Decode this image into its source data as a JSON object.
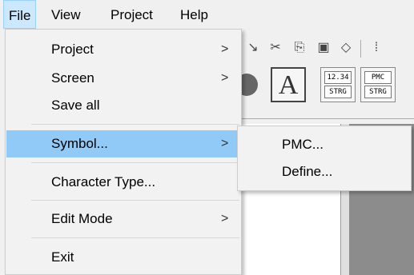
{
  "menubar": {
    "items": [
      {
        "label": "File",
        "active": true
      },
      {
        "label": "View"
      },
      {
        "label": "Project"
      },
      {
        "label": "Help"
      }
    ]
  },
  "file_menu": {
    "items": [
      {
        "label": "Project",
        "submenu": true
      },
      {
        "label": "Screen",
        "submenu": true
      },
      {
        "label": "Save all"
      },
      {
        "label": "Symbol...",
        "submenu": true,
        "highlighted": true
      },
      {
        "label": "Character Type..."
      },
      {
        "label": "Edit Mode",
        "submenu": true
      },
      {
        "label": "Exit"
      }
    ],
    "arrow_glyph": ">"
  },
  "symbol_submenu": {
    "items": [
      {
        "label": "PMC..."
      },
      {
        "label": "Define..."
      }
    ]
  },
  "toolbar": {
    "text_tool_glyph": "A",
    "numeric_box": {
      "top": "12.34",
      "bottom": "STRG"
    },
    "pmc_box": {
      "top": "PMC",
      "bottom": "STRG"
    }
  },
  "colors": {
    "highlight": "#91c9f7",
    "menubar_active": "#cce8ff",
    "canvas_gray": "#8c8c8c"
  }
}
